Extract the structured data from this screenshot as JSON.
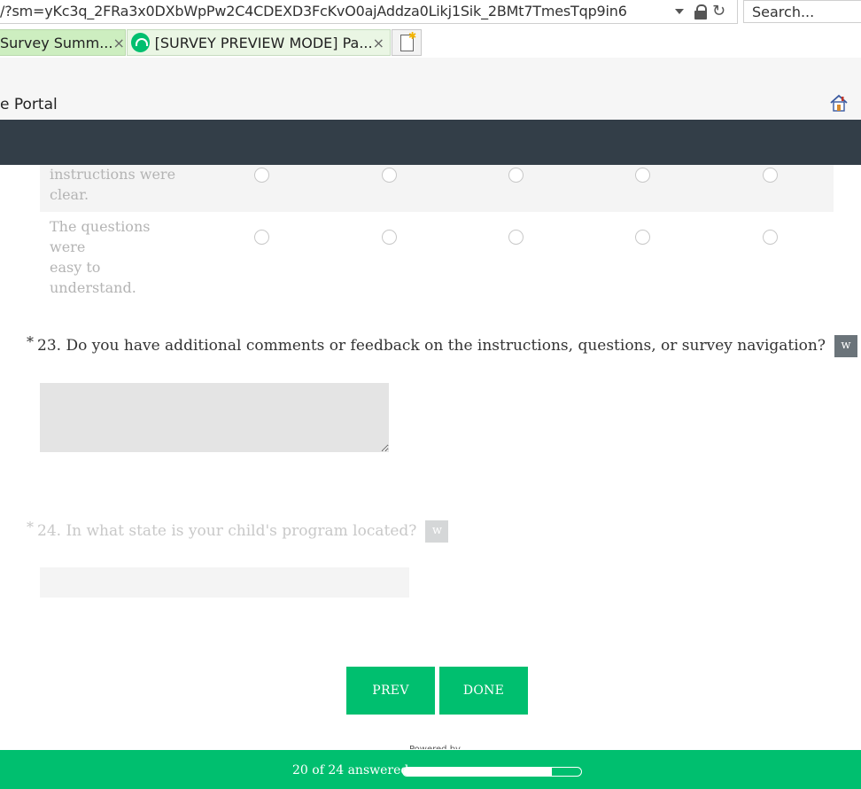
{
  "browser": {
    "url": "/?sm=yKc3q_2FRa3x0DXbWpPw2C4CDEXD3FcKvO0ajAddza0Likj1Sik_2BMt7TmesTqp9in6",
    "search_placeholder": "Search...",
    "tabs": [
      {
        "label": "Survey Summ...",
        "close": "×"
      },
      {
        "label": "[SURVEY PREVIEW MODE] Pa...",
        "close": "×"
      }
    ],
    "icons": [
      "dropdown-caret-icon",
      "lock-icon",
      "reload-icon",
      "new-tab-icon",
      "home-icon"
    ]
  },
  "portal": {
    "title": "e Portal"
  },
  "matrix": {
    "rows": [
      {
        "label_line1": "instructions were",
        "label_line2": "clear."
      },
      {
        "label_line1": "The questions were",
        "label_line2": "easy to understand."
      }
    ],
    "choices_per_row": 5
  },
  "questions": {
    "q23": {
      "required_mark": "*",
      "text": "23. Do you have additional comments or feedback on the instructions, questions, or survey navigation?",
      "badge": "w"
    },
    "q24": {
      "required_mark": "*",
      "text": "24. In what state is your child's program located?",
      "badge": "w"
    }
  },
  "nav": {
    "prev_label": "PREV",
    "done_label": "DONE"
  },
  "footer": {
    "powered_by": "Powered by",
    "progress_text": "20 of 24 answered",
    "answered": 20,
    "total": 24
  },
  "colors": {
    "accent": "#00bf6f",
    "header_dark": "#333e48"
  }
}
